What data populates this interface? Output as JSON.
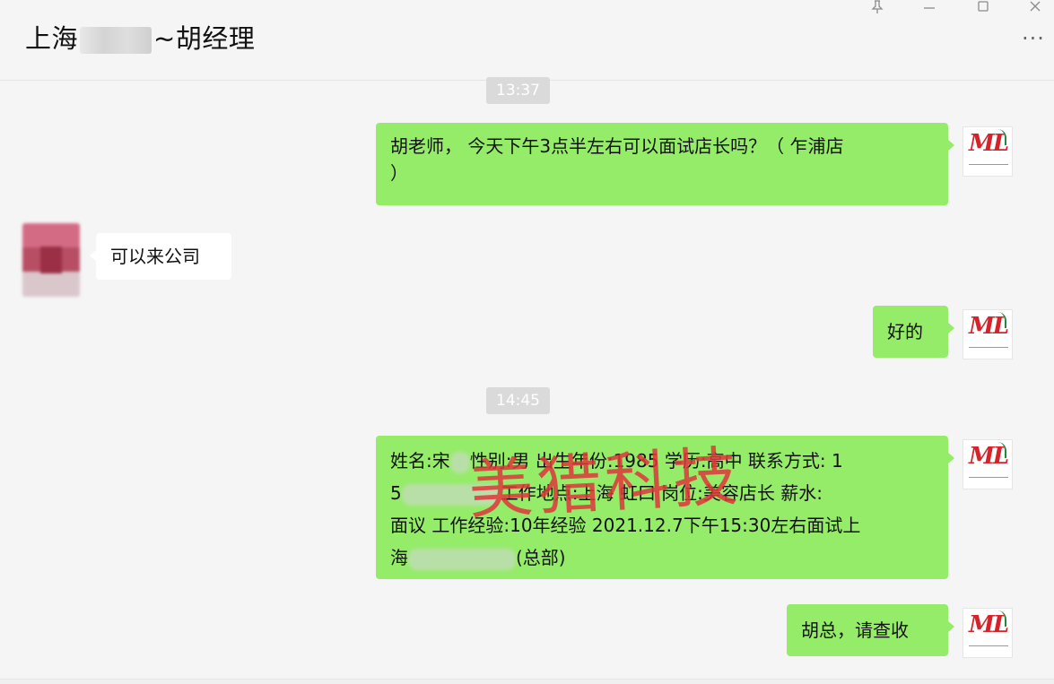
{
  "header": {
    "title_prefix": "上海",
    "title_suffix": "~胡经理",
    "pin_icon": "pin-icon",
    "minimize_icon": "minimize-icon",
    "maximize_icon": "maximize-icon",
    "close_icon": "close-icon",
    "more_icon": "more-icon"
  },
  "messages": {
    "time1": "13:37",
    "msg1_line1": "胡老师， 今天下午3点半左右可以面试店长吗？（ 乍浦店",
    "msg1_line2": "）",
    "msg2": "可以来公司",
    "msg3": "好的",
    "time2": "14:45",
    "msg4_line1a": "姓名:宋",
    "msg4_line1b": "性别:男 出生年份:1985 学历:高中 联系方式: 1",
    "msg4_line2a": "5",
    "msg4_line2b": "工作地点:上海 虹口 岗位:美容店长 薪水:",
    "msg4_line3": "面议 工作经验:10年经验 2021.12.7下午15:30左右面试上",
    "msg4_line4a": "海",
    "msg4_line4b": "(总部)",
    "msg5": "胡总，请查收"
  },
  "avatar": {
    "logo_text": "ML",
    "sub_text": "www.meilielietou.com"
  },
  "watermark": "美猎科技"
}
